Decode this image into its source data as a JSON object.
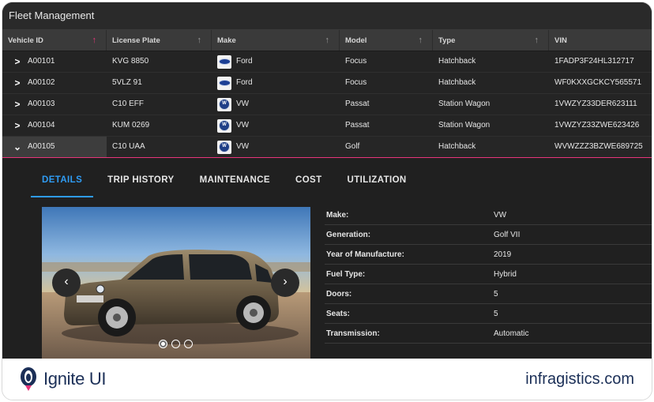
{
  "app": {
    "title": "Fleet Management"
  },
  "grid": {
    "columns": [
      {
        "label": "Vehicle ID",
        "sort": "↑",
        "sort_active": true
      },
      {
        "label": "License Plate",
        "sort": "↑",
        "sort_active": false
      },
      {
        "label": "Make",
        "sort": "↑",
        "sort_active": false
      },
      {
        "label": "Model",
        "sort": "↑",
        "sort_active": false
      },
      {
        "label": "Type",
        "sort": "↑",
        "sort_active": false
      },
      {
        "label": "VIN",
        "sort": "",
        "sort_active": false
      }
    ],
    "rows": [
      {
        "id": "A00101",
        "plate": "KVG 8850",
        "make": "Ford",
        "logo": "ford-logo-icon",
        "model": "Focus",
        "type": "Hatchback",
        "vin": "1FADP3F24HL312717",
        "expanded": false
      },
      {
        "id": "A00102",
        "plate": "5VLZ 91",
        "make": "Ford",
        "logo": "ford-logo-icon",
        "model": "Focus",
        "type": "Hatchback",
        "vin": "WF0KXXGCKCY565571",
        "expanded": false
      },
      {
        "id": "A00103",
        "plate": "C10 EFF",
        "make": "VW",
        "logo": "vw-logo-icon",
        "model": "Passat",
        "type": "Station Wagon",
        "vin": "1VWZYZ33DER623111",
        "expanded": false
      },
      {
        "id": "A00104",
        "plate": "KUM 0269",
        "make": "VW",
        "logo": "vw-logo-icon",
        "model": "Passat",
        "type": "Station Wagon",
        "vin": "1VWZYZ33ZWE623426",
        "expanded": false
      },
      {
        "id": "A00105",
        "plate": "C10 UAA",
        "make": "VW",
        "logo": "vw-logo-icon",
        "model": "Golf",
        "type": "Hatchback",
        "vin": "WVWZZZ3BZWE689725",
        "expanded": true
      }
    ]
  },
  "detail": {
    "tabs": [
      {
        "label": "DETAILS",
        "active": true
      },
      {
        "label": "TRIP HISTORY",
        "active": false
      },
      {
        "label": "MAINTENANCE",
        "active": false
      },
      {
        "label": "COST",
        "active": false
      },
      {
        "label": "UTILIZATION",
        "active": false
      }
    ],
    "carousel": {
      "prev_icon": "‹",
      "next_icon": "›",
      "slides": 3,
      "active_slide": 0
    },
    "properties": [
      {
        "key": "Make:",
        "value": "VW"
      },
      {
        "key": "Generation:",
        "value": "Golf VII"
      },
      {
        "key": "Year of Manufacture:",
        "value": "2019"
      },
      {
        "key": "Fuel Type:",
        "value": "Hybrid"
      },
      {
        "key": "Doors:",
        "value": "5"
      },
      {
        "key": "Seats:",
        "value": "5"
      },
      {
        "key": "Transmission:",
        "value": "Automatic"
      }
    ]
  },
  "footer": {
    "brand": "Ignite UI",
    "site": "infragistics.com"
  },
  "colors": {
    "accent_pink": "#e8357a",
    "accent_blue": "#2f9cf4",
    "brand_navy": "#1b2f57"
  }
}
